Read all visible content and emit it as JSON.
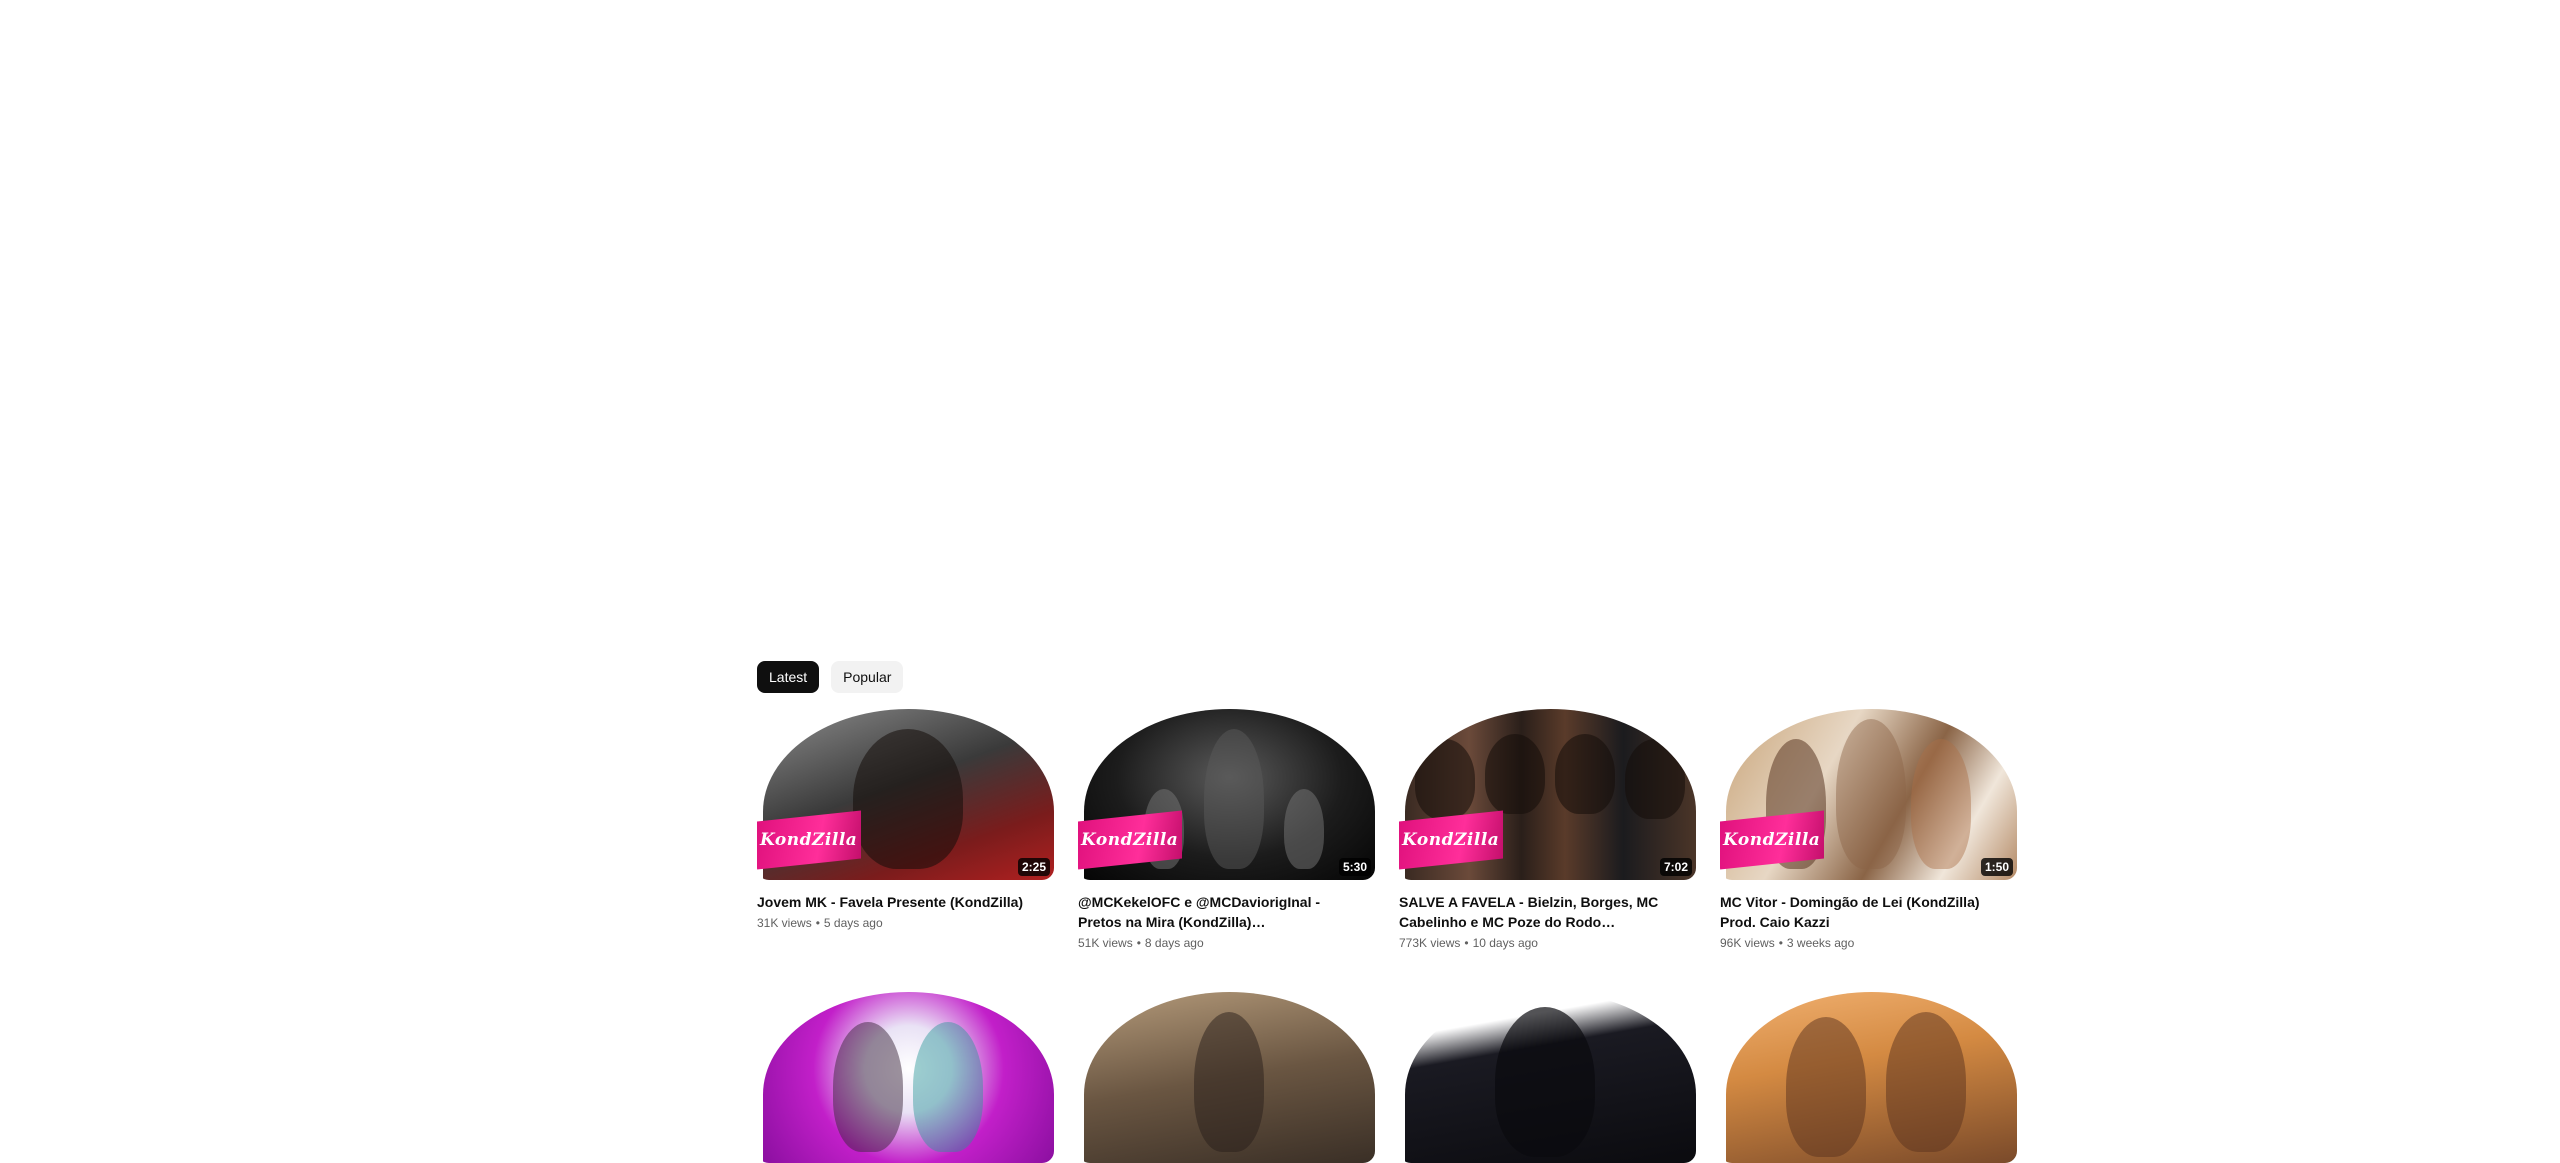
{
  "tabs": {
    "latest": "Latest",
    "popular": "Popular"
  },
  "logo_text": "KondZilla",
  "videos": [
    {
      "title": "Jovem MK - Favela Presente (KondZilla)",
      "views": "31K views",
      "age": "5 days ago",
      "duration": "2:25"
    },
    {
      "title": "@MCKekelOFC e @MCDaviorigInal - Pretos na Mira (KondZilla) @pereradjoriginal",
      "views": "51K views",
      "age": "8 days ago",
      "duration": "5:30"
    },
    {
      "title": "SALVE A FAVELA - Bielzin, Borges, MC Cabelinho e MC Poze do Rodo (KondZilla) Prod. ...",
      "views": "773K views",
      "age": "10 days ago",
      "duration": "7:02"
    },
    {
      "title": "MC Vitor - Domingão de Lei (KondZilla) Prod. Caio Kazzi",
      "views": "96K views",
      "age": "3 weeks ago",
      "duration": "1:50"
    }
  ],
  "separator": "•"
}
